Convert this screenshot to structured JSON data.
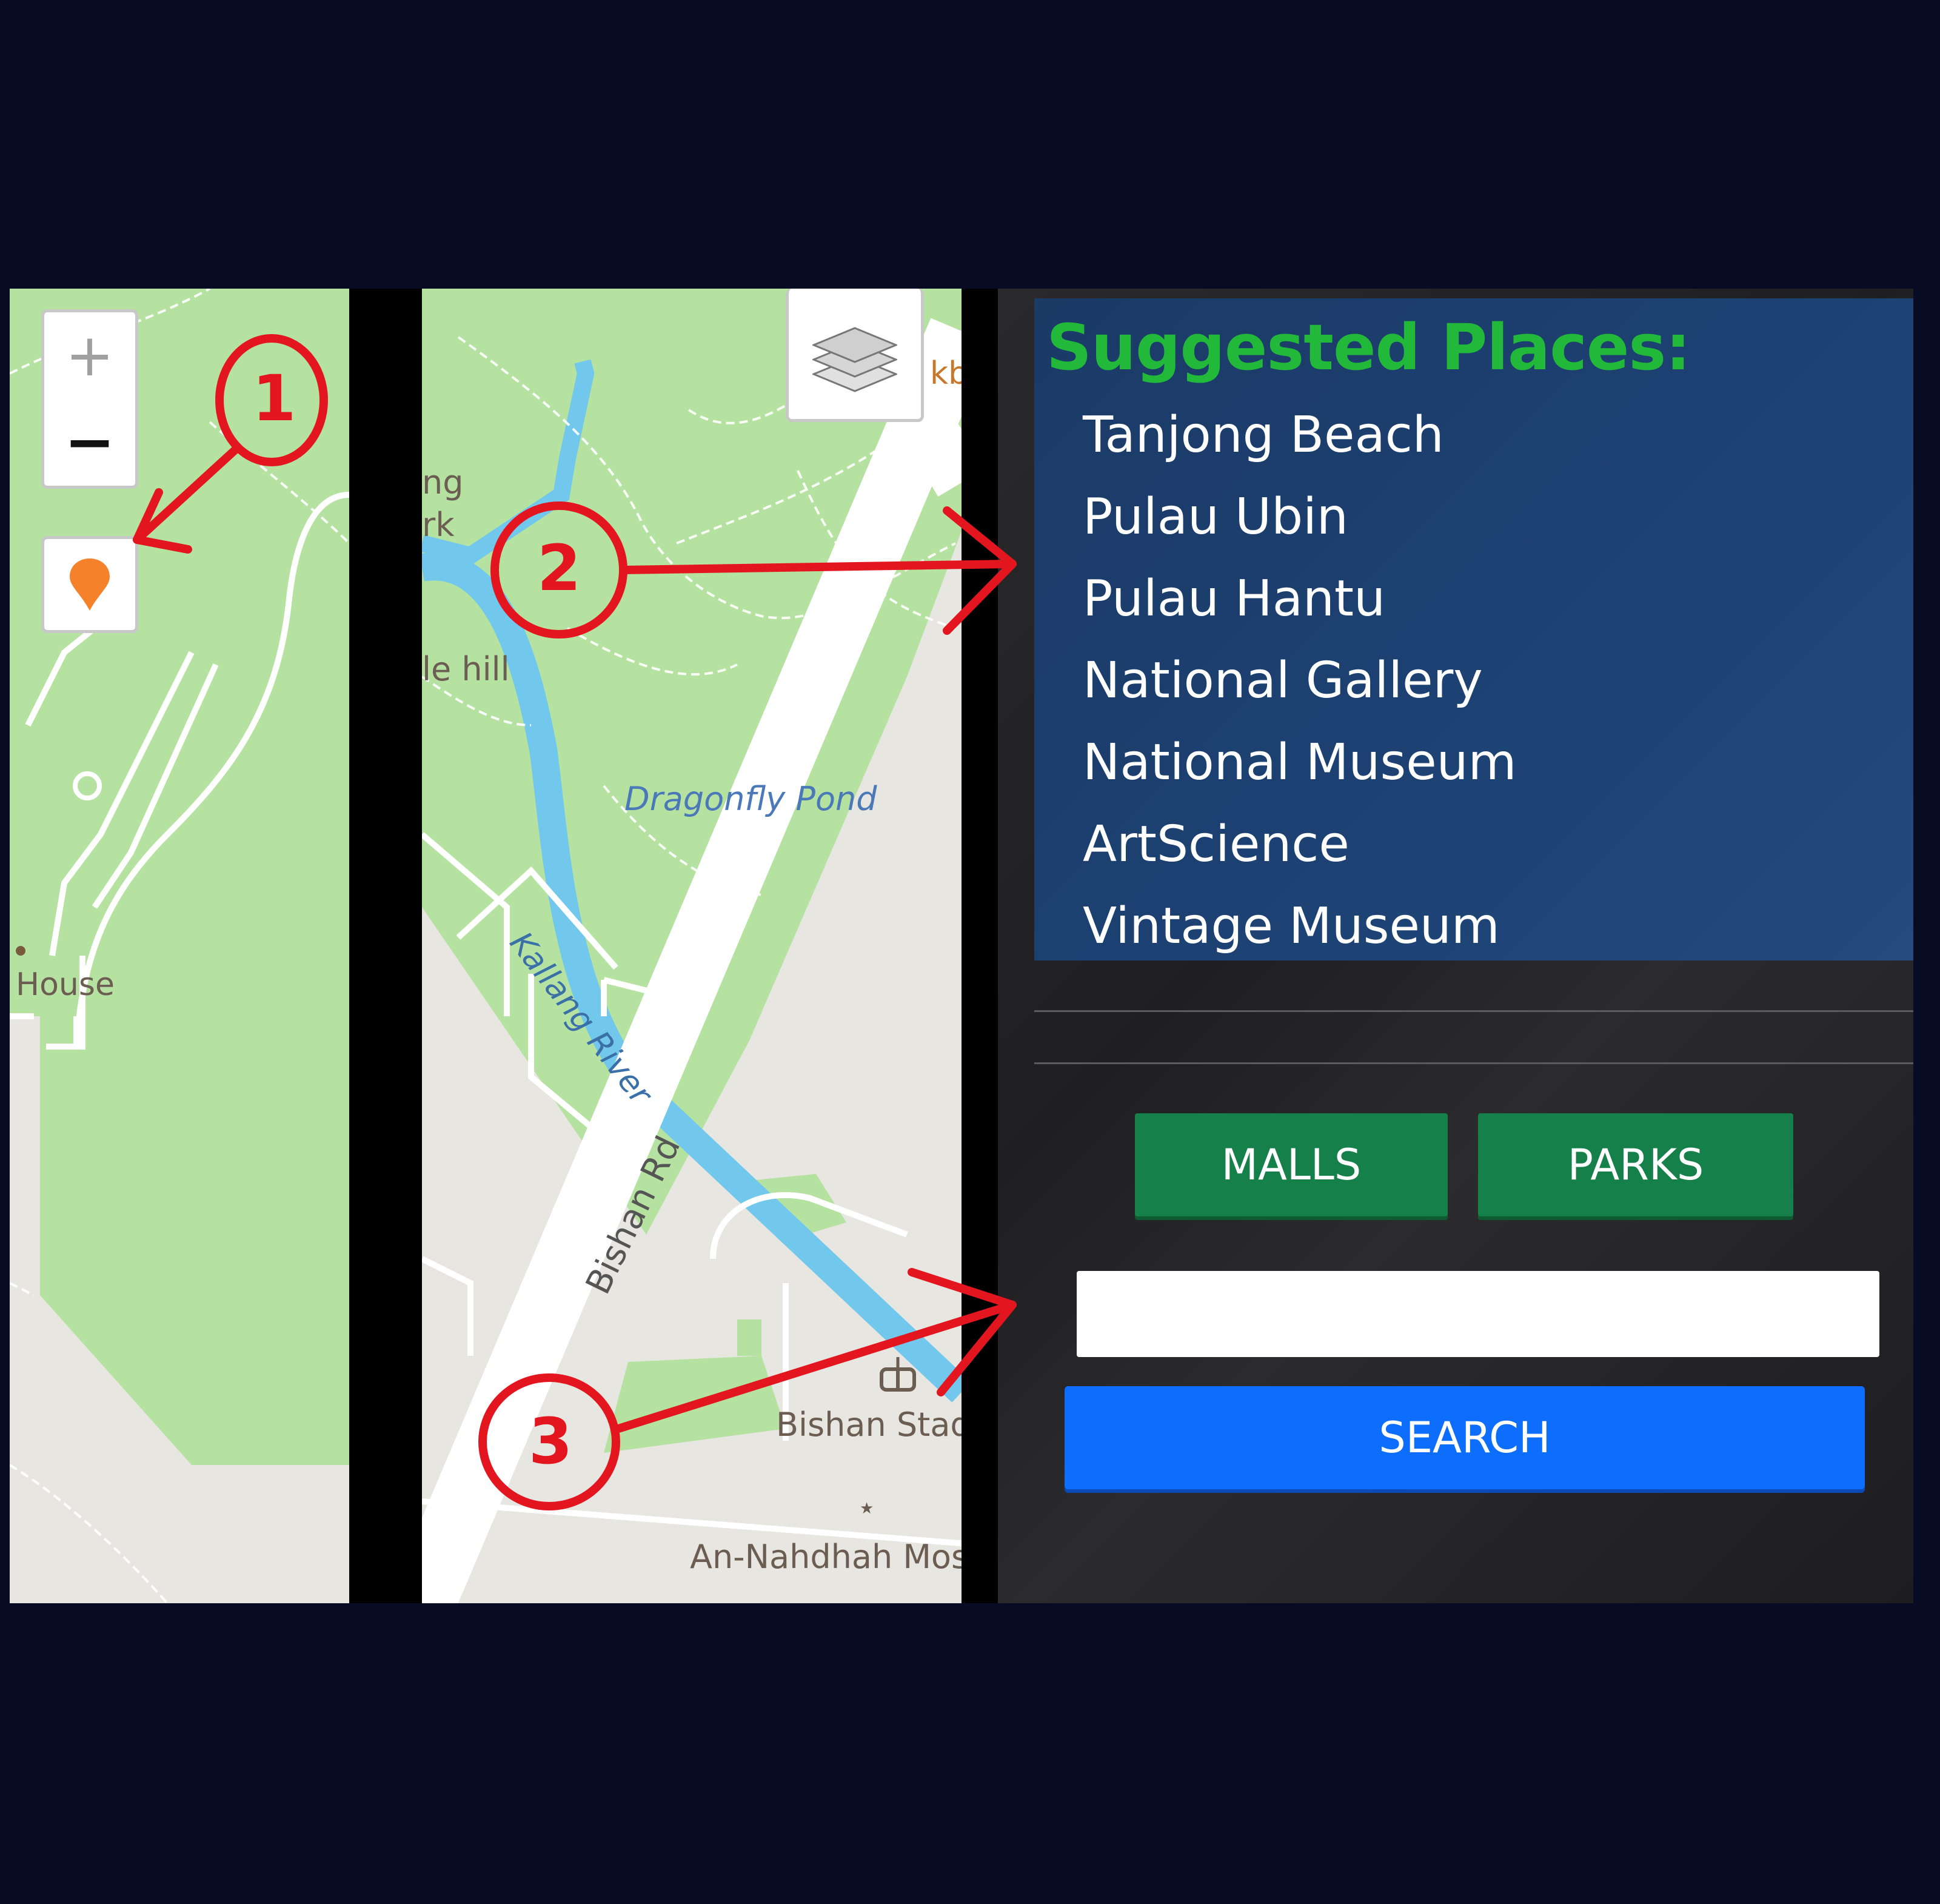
{
  "map_left": {
    "zoom_in_label": "+",
    "zoom_out_label": "−",
    "label_house": "House",
    "marker_color": "#f5822a"
  },
  "map_middle": {
    "label_park_partial_1": "ng",
    "label_park_partial_2": "rk",
    "label_hill": "le hill",
    "label_pond": "Dragonfly Pond",
    "label_river": "Kallang River",
    "label_road": "Bishan Rd",
    "label_stadium": "Bishan Stad",
    "label_mosque": "An-Nahdhah Mos",
    "label_partial_top": "kb"
  },
  "sidebar": {
    "title": "Suggested Places:",
    "places": [
      "Tanjong Beach",
      "Pulau Ubin",
      "Pulau Hantu",
      "National Gallery",
      "National Museum",
      "ArtScience",
      "Vintage Museum"
    ],
    "malls_label": "MALLS",
    "parks_label": "PARKS",
    "search_value": "",
    "search_label": "SEARCH"
  },
  "annotations": {
    "one": "1",
    "two": "2",
    "three": "3",
    "color": "#e3161f"
  },
  "colors": {
    "background": "#070b24",
    "title_green": "#22b83a",
    "button_green": "#16804a",
    "search_blue": "#0d6efd",
    "park_green": "#b5e2a0",
    "water_blue": "#72c8ec"
  }
}
